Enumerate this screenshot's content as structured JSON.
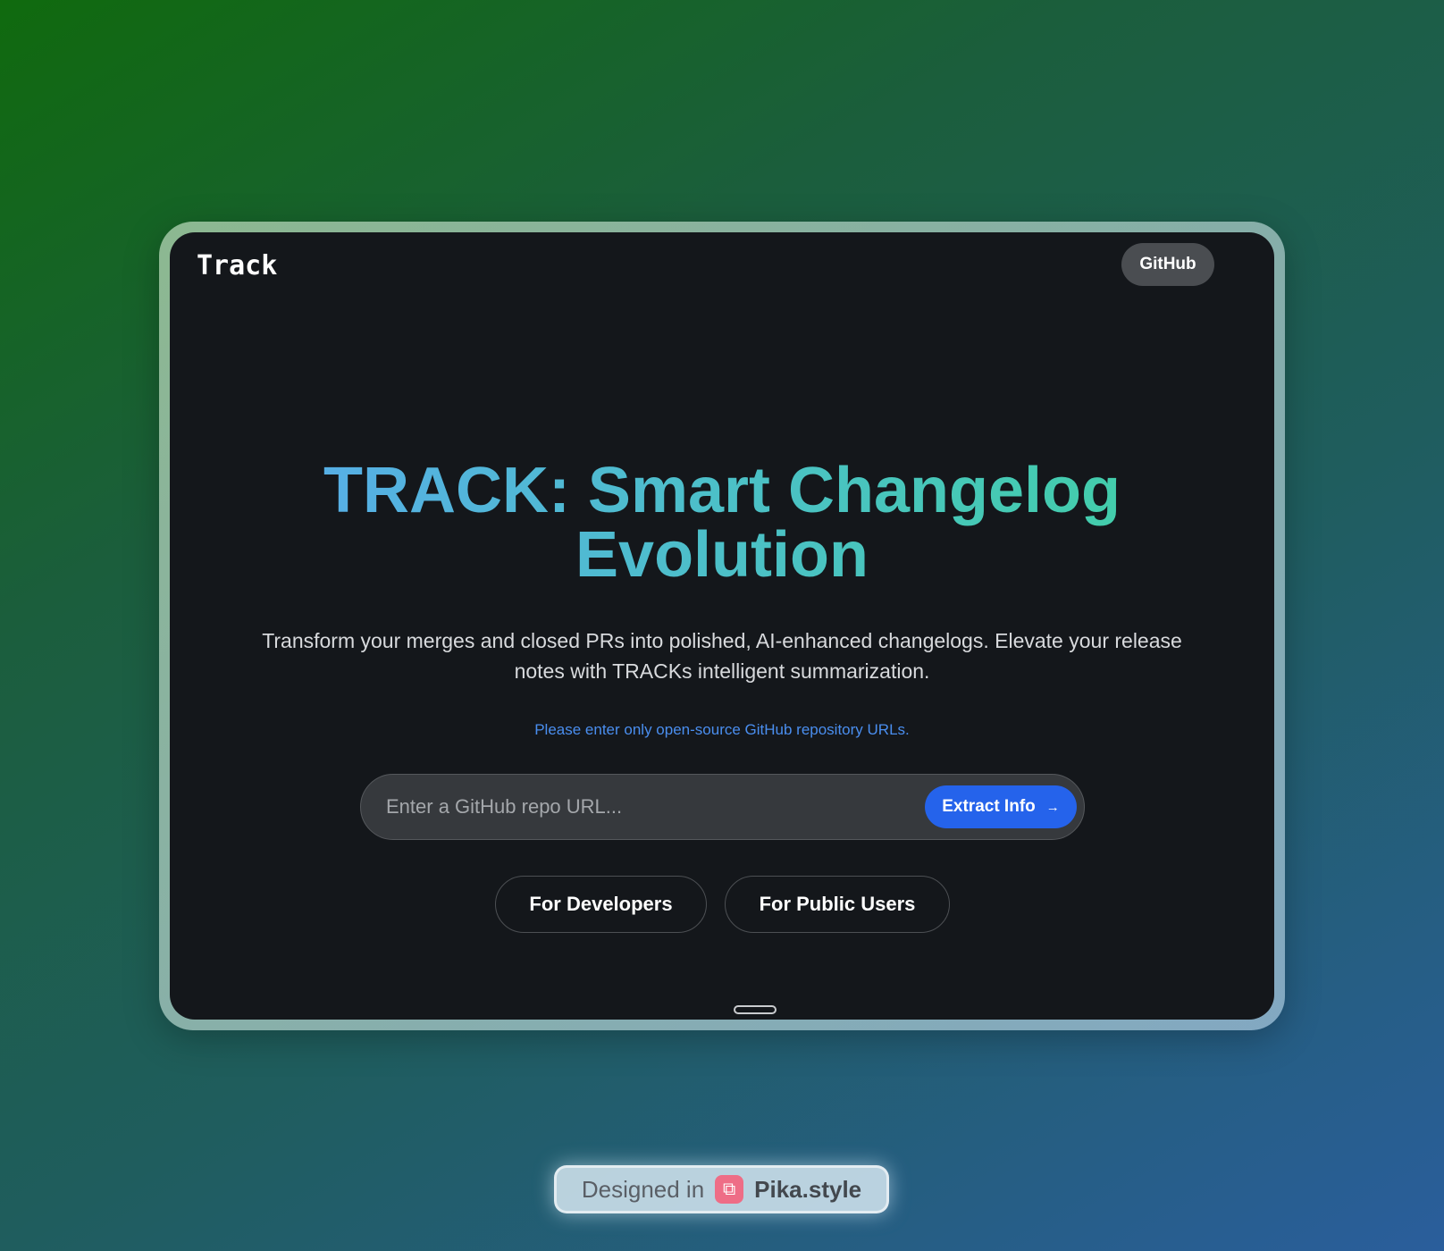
{
  "header": {
    "logo": "Track",
    "github_label": "GitHub"
  },
  "hero": {
    "title_line1": "TRACK: Smart Changelog",
    "title_line2": "Evolution",
    "subtitle": "Transform your merges and closed PRs into polished, AI-enhanced changelogs. Elevate your release notes with TRACKs intelligent summarization.",
    "notice": "Please enter only open-source GitHub repository URLs."
  },
  "search": {
    "placeholder": "Enter a GitHub repo URL...",
    "button_label": "Extract Info",
    "button_icon": "→"
  },
  "roles": {
    "developers": "For Developers",
    "public_users": "For Public Users"
  },
  "credit": {
    "prefix": "Designed in",
    "brand": "Pika.style",
    "icon": "⧉"
  },
  "colors": {
    "accent": "#2563eb",
    "title_gradient": [
      "#5aa8f0",
      "#3fd2a0"
    ],
    "notice": "#4a8eef",
    "screen_bg": "#14171b"
  }
}
